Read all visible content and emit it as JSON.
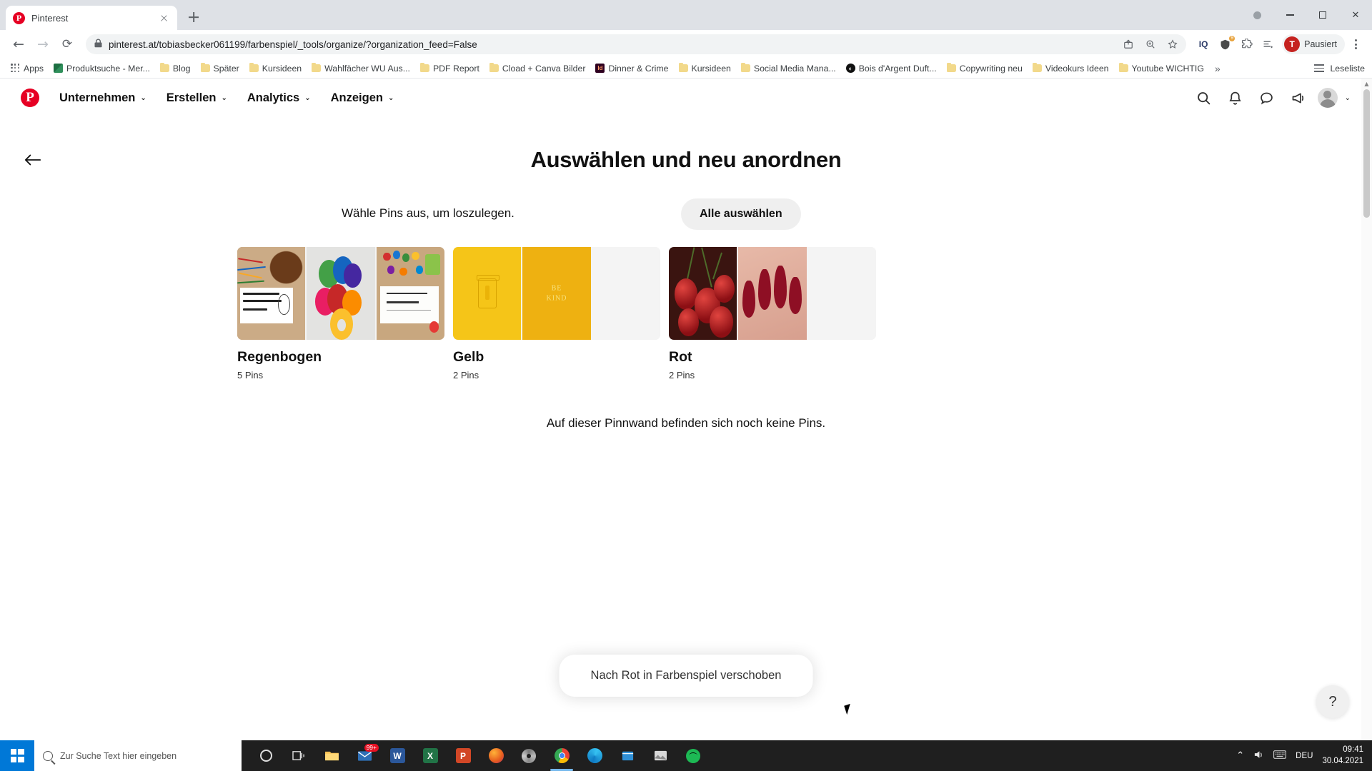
{
  "browser": {
    "tab": {
      "title": "Pinterest",
      "favicon": "pinterest-icon",
      "close": "×"
    },
    "new_tab_label": "+",
    "window_controls": {
      "minimize": "—",
      "maximize": "▢",
      "close": "✕"
    },
    "nav": {
      "back": "←",
      "forward": "→",
      "reload": "⟳"
    },
    "omnibox": {
      "lock": "🔒",
      "url": "pinterest.at/tobiasbecker061199/farbenspiel/_tools/organize/?organization_feed=False",
      "icons": [
        "share-icon",
        "zoom-icon",
        "bookmark-star-icon"
      ]
    },
    "extensions": [
      {
        "name": "iq-extension",
        "label": "IQ"
      },
      {
        "name": "badge-extension",
        "label": ""
      },
      {
        "name": "puzzle-extension",
        "label": ""
      },
      {
        "name": "list-extension",
        "label": ""
      }
    ],
    "profile": {
      "initial": "T",
      "label": "Pausiert"
    },
    "menu": "⋮",
    "bookmarks": [
      {
        "label": "Apps",
        "icon": "apps-grid-icon"
      },
      {
        "label": "Produktsuche - Mer...",
        "icon": "site-favicon"
      },
      {
        "label": "Blog",
        "icon": "folder-icon"
      },
      {
        "label": "Später",
        "icon": "folder-icon"
      },
      {
        "label": "Kursideen",
        "icon": "folder-icon"
      },
      {
        "label": "Wahlfächer WU Aus...",
        "icon": "folder-icon"
      },
      {
        "label": "PDF Report",
        "icon": "folder-icon"
      },
      {
        "label": "Cload + Canva Bilder",
        "icon": "folder-icon"
      },
      {
        "label": "Dinner & Crime",
        "icon": "indesign-favicon"
      },
      {
        "label": "Kursideen",
        "icon": "folder-icon"
      },
      {
        "label": "Social Media Mana...",
        "icon": "folder-icon"
      },
      {
        "label": "Bois d'Argent Duft...",
        "icon": "dark-favicon"
      },
      {
        "label": "Copywriting neu",
        "icon": "folder-icon"
      },
      {
        "label": "Videokurs Ideen",
        "icon": "folder-icon"
      },
      {
        "label": "Youtube WICHTIG",
        "icon": "folder-icon"
      }
    ],
    "bookmarks_overflow": "»",
    "reading_list": "Leseliste"
  },
  "pinterest": {
    "logo": "P",
    "nav_items": [
      {
        "label": "Unternehmen",
        "caret": "⌄"
      },
      {
        "label": "Erstellen",
        "caret": "⌄"
      },
      {
        "label": "Analytics",
        "caret": "⌄"
      },
      {
        "label": "Anzeigen",
        "caret": "⌄"
      }
    ],
    "header_icons": [
      "search-icon",
      "bell-icon",
      "chat-icon",
      "megaphone-icon"
    ],
    "account_caret": "⌄",
    "back_button": "←",
    "page_title": "Auswählen und neu anordnen",
    "instruction": "Wähle Pins aus, um loszulegen.",
    "select_all_button": "Alle auswählen",
    "boards": [
      {
        "name": "Regenbogen",
        "count": "5 Pins"
      },
      {
        "name": "Gelb",
        "count": "2 Pins"
      },
      {
        "name": "Rot",
        "count": "2 Pins"
      }
    ],
    "empty_note": "Auf dieser Pinnwand befinden sich noch keine Pins.",
    "toast": "Nach Rot in Farbenspiel verschoben",
    "help_button": "?",
    "colors": {
      "brand": "#e60023",
      "button_bg": "#efefef",
      "text": "#111111"
    }
  },
  "taskbar": {
    "search_placeholder": "Zur Suche Text hier eingeben",
    "apps": [
      {
        "name": "cortana",
        "label": ""
      },
      {
        "name": "task-view",
        "label": ""
      },
      {
        "name": "file-explorer",
        "label": ""
      },
      {
        "name": "mail",
        "label": "",
        "badge": "99+"
      },
      {
        "name": "word",
        "label": "W"
      },
      {
        "name": "excel",
        "label": "X"
      },
      {
        "name": "powerpoint",
        "label": "P"
      },
      {
        "name": "firefox",
        "label": ""
      },
      {
        "name": "disc",
        "label": ""
      },
      {
        "name": "chrome",
        "label": ""
      },
      {
        "name": "edge",
        "label": ""
      },
      {
        "name": "store",
        "label": ""
      },
      {
        "name": "photos",
        "label": ""
      },
      {
        "name": "spotify",
        "label": ""
      }
    ],
    "tray": {
      "chevron": "⌃",
      "volume": "🔊",
      "keyboard": "⌨",
      "language": "DEU"
    },
    "clock": {
      "time": "09:41",
      "date": "30.04.2021"
    }
  }
}
